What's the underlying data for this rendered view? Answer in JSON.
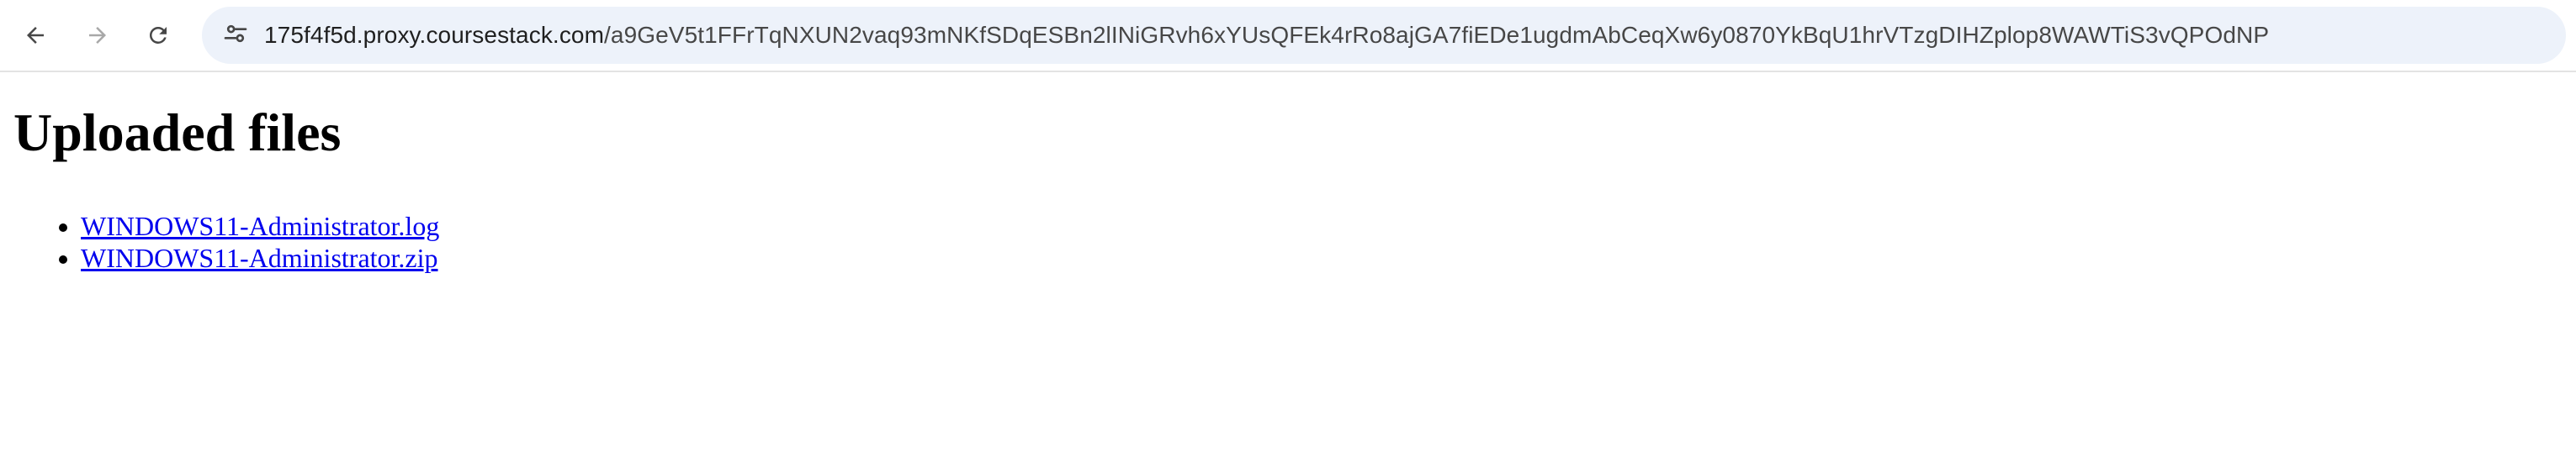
{
  "browser": {
    "nav": {
      "back": "back-arrow-icon",
      "forward": "forward-arrow-icon",
      "reload": "reload-icon"
    },
    "site_info_icon": "tune-icon",
    "url_host": "175f4f5d.proxy.coursestack.com",
    "url_path": "/a9GeV5t1FFrTqNXUN2vaq93mNKfSDqESBn2lINiGRvh6xYUsQFEk4rRo8ajGA7fiEDe1ugdmAbCeqXw6y0870YkBqU1hrVTzgDIHZplop8WAWTiS3vQPOdNP"
  },
  "page": {
    "heading": "Uploaded files",
    "files": [
      {
        "name": "WINDOWS11-Administrator.log"
      },
      {
        "name": "WINDOWS11-Administrator.zip"
      }
    ]
  },
  "colors": {
    "omnibox_bg": "#edf2fa",
    "link": "#0000ee"
  }
}
